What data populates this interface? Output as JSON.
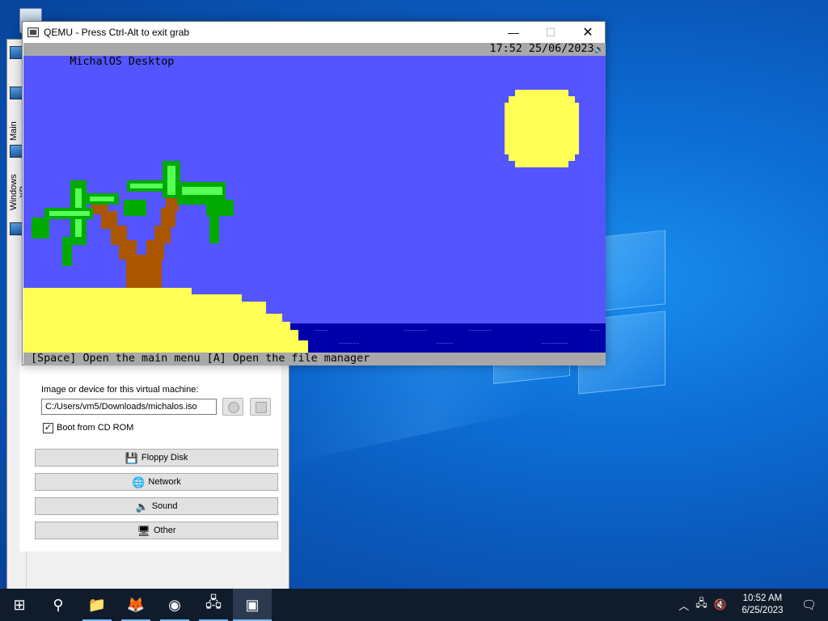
{
  "desktop": {
    "recycle_bin": "recycle-bin"
  },
  "manager": {
    "tab_main": "Main",
    "tab_windows_xp": "Windows XP",
    "image_label": "Image or device for this virtual machine:",
    "image_path": "C:/Users/vm5/Downloads/michalos.iso",
    "boot_cd_label": "Boot from CD ROM",
    "boot_cd_checked": true,
    "buttons": [
      {
        "label": "Floppy Disk",
        "icon": "floppy-icon",
        "glyph": "💾"
      },
      {
        "label": "Network",
        "icon": "globe-icon",
        "glyph": "🌐"
      },
      {
        "label": "Sound",
        "icon": "speaker-icon",
        "glyph": "🔈"
      },
      {
        "label": "Other",
        "icon": "monitor-icon",
        "glyph": "🖥"
      }
    ]
  },
  "qemu": {
    "title": "QEMU - Press Ctrl-Alt to exit grab",
    "minimize": "—",
    "maximize": "☐",
    "close": "✕",
    "os_title": "MichalOS Desktop",
    "os_clock": "17:52 25/06/2023",
    "os_speaker": "🔈",
    "os_hint": "[Space] Open the main menu [A] Open the file manager"
  },
  "taskbar": {
    "time": "10:52 AM",
    "date": "6/25/2023",
    "items": [
      {
        "name": "start-button",
        "glyph": "⊞"
      },
      {
        "name": "search-button",
        "glyph": "⚲"
      },
      {
        "name": "file-explorer",
        "glyph": "📁"
      },
      {
        "name": "firefox",
        "glyph": "🦊"
      },
      {
        "name": "chrome",
        "glyph": "◉"
      },
      {
        "name": "network-app",
        "glyph": "🖧"
      },
      {
        "name": "qemu-app",
        "glyph": "▣"
      }
    ]
  },
  "colors": {
    "sky": "#5555ff",
    "sea": "#0000aa",
    "sand": "#ffff55",
    "trunk": "#aa5500",
    "leaf_dark": "#00aa00",
    "leaf_light": "#55ff55",
    "bar": "#a8a8a8"
  }
}
